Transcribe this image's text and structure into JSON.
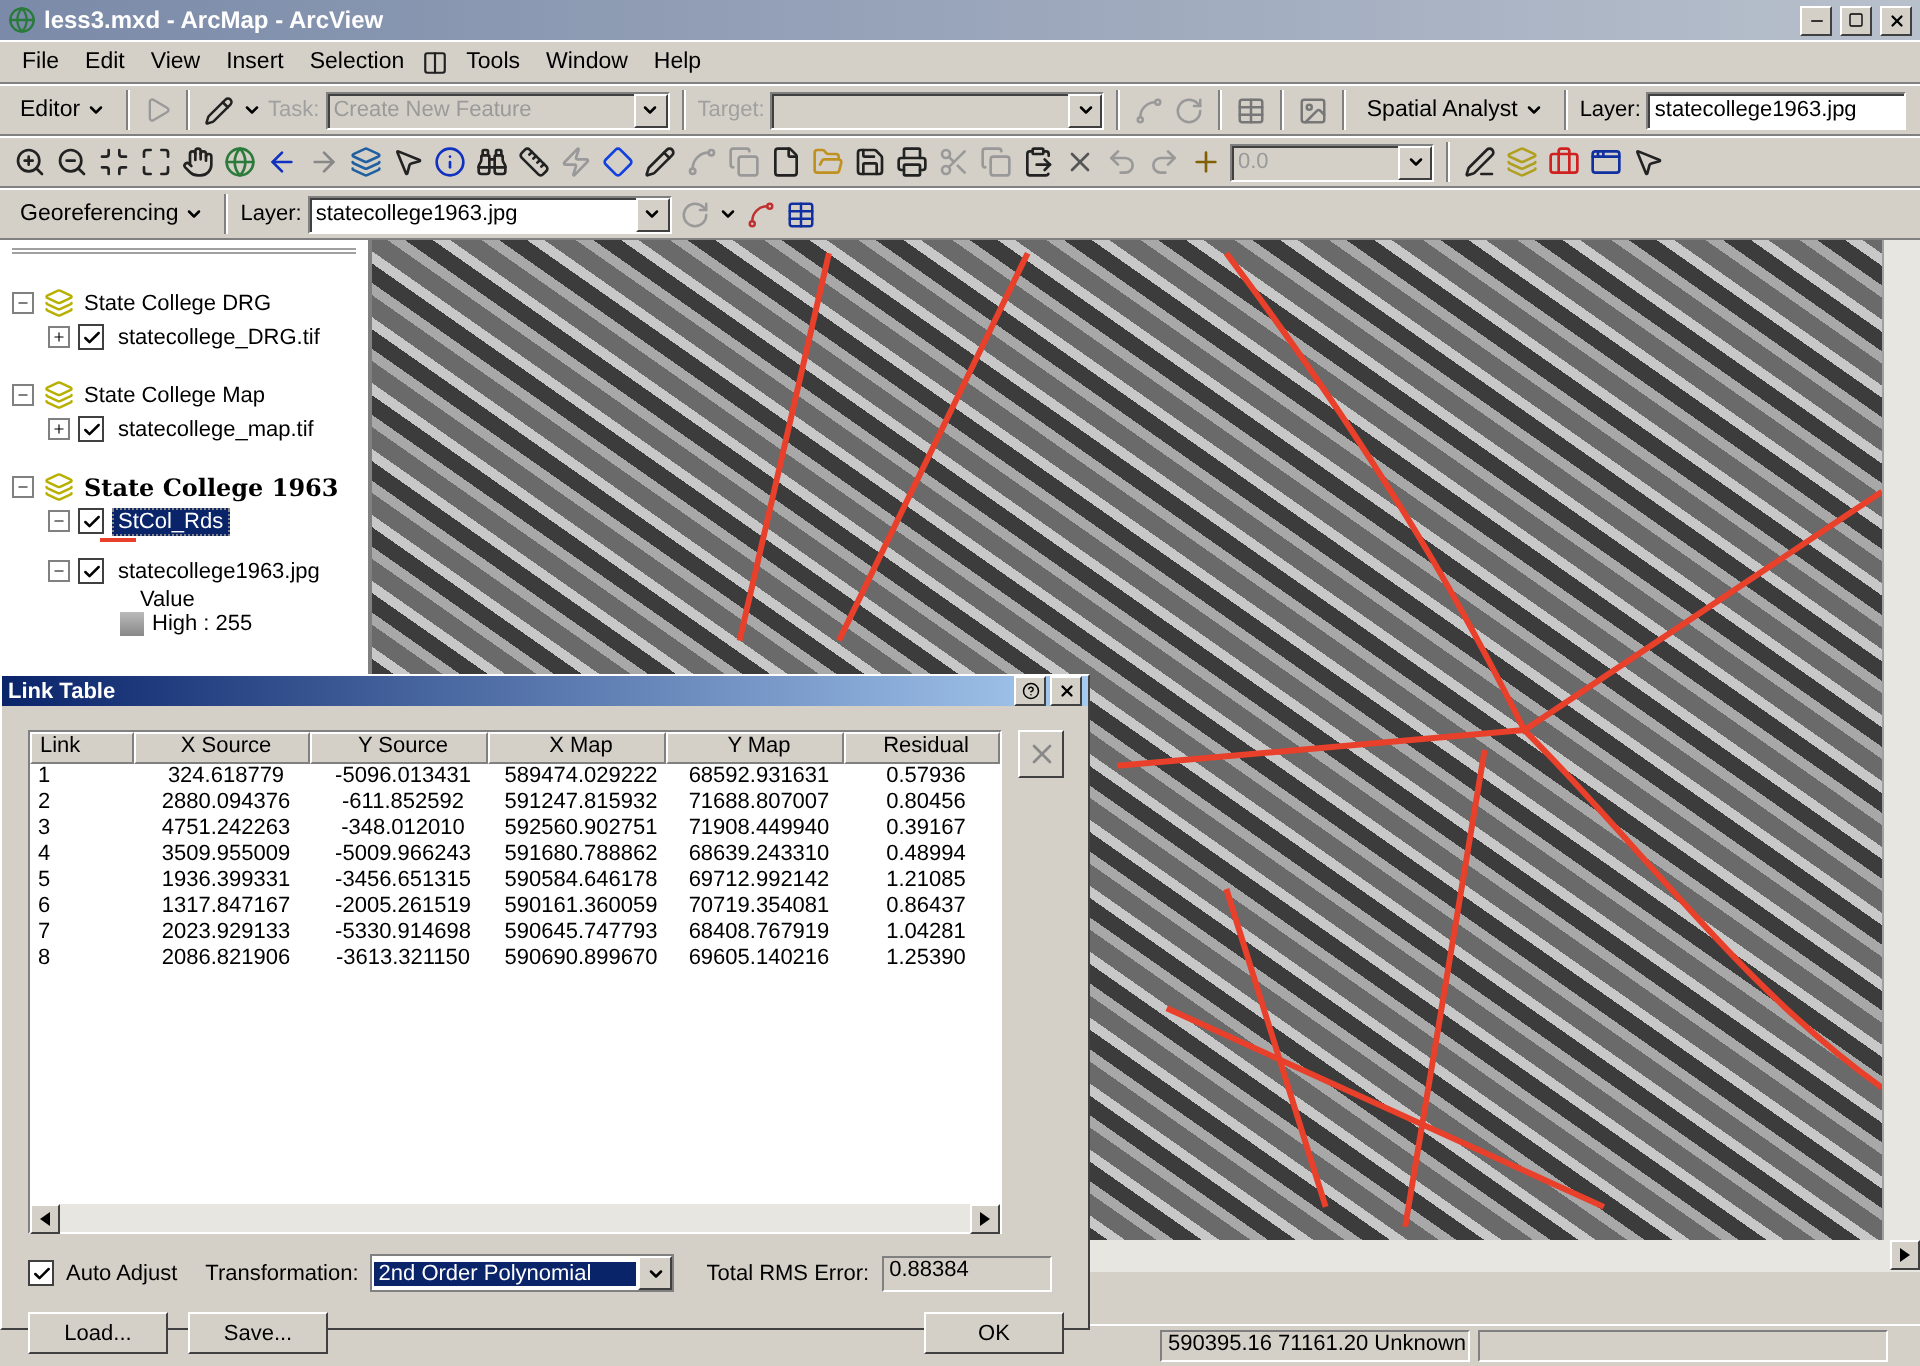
{
  "window": {
    "title": "less3.mxd - ArcMap - ArcView"
  },
  "menu": [
    {
      "kind": "text",
      "label": "File"
    },
    {
      "kind": "text",
      "label": "Edit"
    },
    {
      "kind": "text",
      "label": "View"
    },
    {
      "kind": "text",
      "label": "Insert"
    },
    {
      "kind": "text",
      "label": "Selection"
    },
    {
      "kind": "icon"
    },
    {
      "kind": "text",
      "label": "Tools"
    },
    {
      "kind": "text",
      "label": "Window"
    },
    {
      "kind": "text",
      "label": "Help"
    }
  ],
  "editor_toolbar": {
    "editor_menu": "Editor",
    "task_label": "Task:",
    "task_value": "Create New Feature",
    "task_disabled": true,
    "target_label": "Target:",
    "spatial_analyst_menu": "Spatial Analyst",
    "layer_label": "Layer:",
    "layer_value": "statecollege1963.jpg"
  },
  "tools_toolbar": {
    "scale_value": "0.0"
  },
  "georef_toolbar": {
    "menu": "Georeferencing",
    "layer_label": "Layer:",
    "layer_value": "statecollege1963.jpg"
  },
  "toc": {
    "groups": [
      {
        "name": "State College DRG",
        "active": false,
        "expanded": true,
        "layers": [
          {
            "name": "statecollege_DRG.tif",
            "checked": true,
            "expanded": false,
            "selected": false
          }
        ]
      },
      {
        "name": "State College Map",
        "active": false,
        "expanded": true,
        "layers": [
          {
            "name": "statecollege_map.tif",
            "checked": true,
            "expanded": false,
            "selected": false
          }
        ]
      },
      {
        "name": "State College 1963",
        "active": true,
        "expanded": true,
        "layers": [
          {
            "name": "StCol_Rds",
            "checked": true,
            "expanded": true,
            "selected": true,
            "legend": {
              "kind": "line",
              "color": "#e8402a"
            }
          },
          {
            "name": "statecollege1963.jpg",
            "checked": true,
            "expanded": true,
            "selected": false,
            "legend": {
              "kind": "ramp",
              "heading": "Value",
              "high": "High : 255"
            }
          }
        ]
      }
    ]
  },
  "link_table": {
    "title": "Link Table",
    "columns": [
      "Link",
      "X Source",
      "Y Source",
      "X Map",
      "Y Map",
      "Residual"
    ],
    "rows": [
      [
        "1",
        "324.618779",
        "-5096.013431",
        "589474.029222",
        "68592.931631",
        "0.57936"
      ],
      [
        "2",
        "2880.094376",
        "-611.852592",
        "591247.815932",
        "71688.807007",
        "0.80456"
      ],
      [
        "3",
        "4751.242263",
        "-348.012010",
        "592560.902751",
        "71908.449940",
        "0.39167"
      ],
      [
        "4",
        "3509.955009",
        "-5009.966243",
        "591680.788862",
        "68639.243310",
        "0.48994"
      ],
      [
        "5",
        "1936.399331",
        "-3456.651315",
        "590584.646178",
        "69712.992142",
        "1.21085"
      ],
      [
        "6",
        "1317.847167",
        "-2005.261519",
        "590161.360059",
        "70719.354081",
        "0.86437"
      ],
      [
        "7",
        "2023.929133",
        "-5330.914698",
        "590645.747793",
        "68408.767919",
        "1.04281"
      ],
      [
        "8",
        "2086.821906",
        "-3613.321150",
        "590690.899670",
        "69605.140216",
        "1.25390"
      ]
    ],
    "auto_adjust": {
      "label": "Auto Adjust",
      "checked": true
    },
    "transformation_label": "Transformation:",
    "transformation_value": "2nd Order Polynomial",
    "rms_label": "Total RMS Error:",
    "rms_value": "0.88384",
    "buttons": [
      "Load...",
      "Save..."
    ],
    "ok": "OK"
  },
  "status_bar": {
    "coordinates": "590395.16 71161.20 Unknown"
  }
}
